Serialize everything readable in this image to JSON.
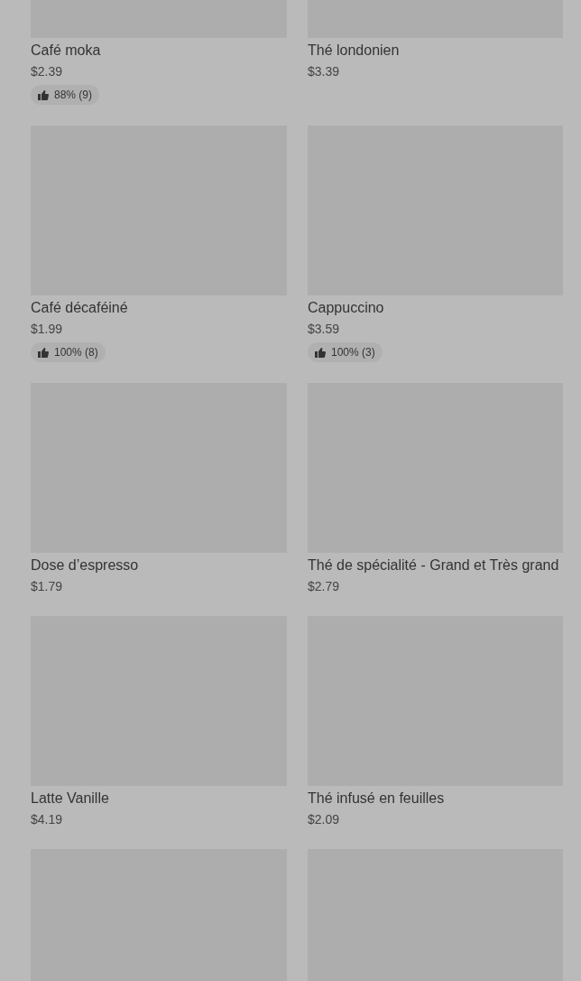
{
  "products": [
    {
      "kind": "product",
      "name": "Café moka",
      "price": "$2.39",
      "rating": "88% (9)"
    },
    {
      "kind": "product",
      "name": "Thé londonien",
      "price": "$3.39"
    },
    {
      "kind": "product",
      "name": "Café décaféiné",
      "price": "$1.99",
      "rating": "100% (8)"
    },
    {
      "kind": "product",
      "name": "Cappuccino",
      "price": "$3.59",
      "rating": "100% (3)"
    },
    {
      "kind": "product",
      "name": "Dose d’espresso",
      "price": "$1.79"
    },
    {
      "kind": "product",
      "name": "Thé de spécialité - Grand et Très grand",
      "price": "$2.79"
    },
    {
      "kind": "product",
      "name": "Latte Vanille",
      "price": "$4.19"
    },
    {
      "kind": "product",
      "name": "Thé infusé en feuilles",
      "price": "$2.09"
    },
    {
      "kind": "image_only"
    },
    {
      "kind": "image_only"
    }
  ]
}
